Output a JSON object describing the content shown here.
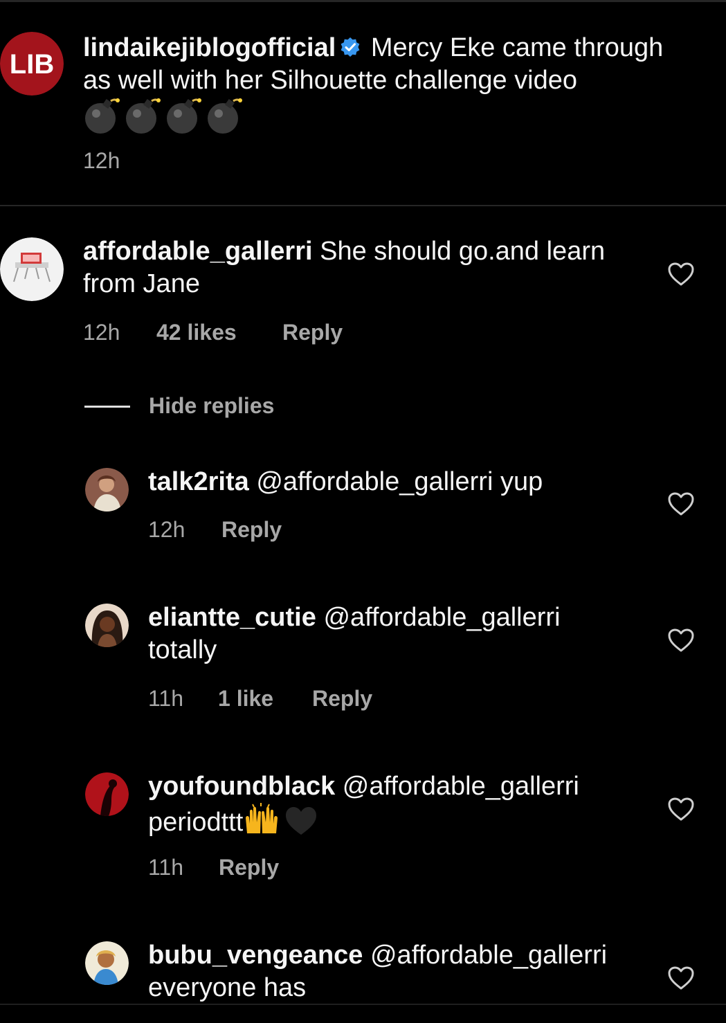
{
  "caption": {
    "username": "lindaikejiblogofficial",
    "text": "Mercy Eke came through as well with her Silhouette challenge video",
    "emoji": "💣💣💣💣",
    "time": "12h",
    "avatar_text": "LIB"
  },
  "comment": {
    "username": "affordable_gallerri",
    "text": "She should go.and learn from Jane",
    "time": "12h",
    "likes": "42 likes",
    "reply_label": "Reply"
  },
  "hide_replies_label": "Hide replies",
  "replies": [
    {
      "username": "talk2rita",
      "text": "@affordable_gallerri yup",
      "time": "12h",
      "likes": "",
      "reply_label": "Reply"
    },
    {
      "username": "eliantte_cutie",
      "text": "@affordable_gallerri totally",
      "time": "11h",
      "likes": "1 like",
      "reply_label": "Reply"
    },
    {
      "username": "youfoundblack",
      "text": "@affordable_gallerri periodttt",
      "emoji": "🙌🖤",
      "time": "11h",
      "likes": "",
      "reply_label": "Reply"
    },
    {
      "username": "bubu_vengeance",
      "text": "@affordable_gallerri everyone has",
      "time": "",
      "likes": "",
      "reply_label": ""
    }
  ],
  "colors": {
    "background": "#000000",
    "text": "#f5f5f5",
    "secondary": "#a8a8a8",
    "verified": "#3897f0",
    "lib_red": "#a3141c"
  }
}
